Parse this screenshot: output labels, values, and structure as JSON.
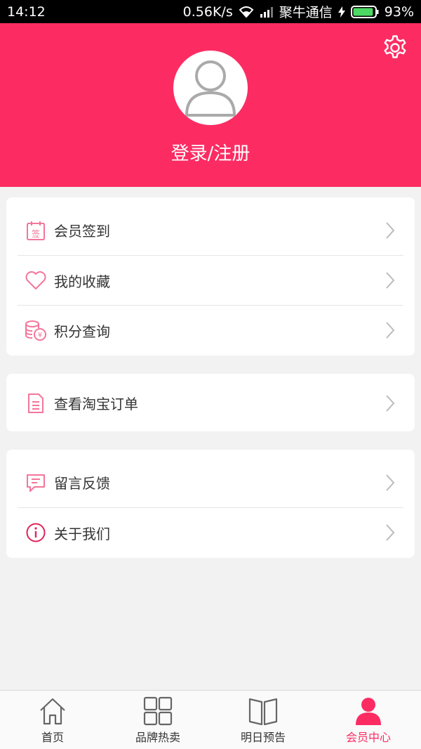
{
  "status_bar": {
    "time": "14:12",
    "speed": "0.56K/s",
    "carrier": "聚牛通信",
    "battery": "93%",
    "battery_level": 0.93
  },
  "header": {
    "login_label": "登录/注册",
    "accent_color": "#fc2c63"
  },
  "menu": {
    "group1": [
      {
        "label": "会员签到",
        "icon": "sign-in-calendar-icon"
      },
      {
        "label": "我的收藏",
        "icon": "heart-icon"
      },
      {
        "label": "积分查询",
        "icon": "coins-icon"
      }
    ],
    "group2": [
      {
        "label": "查看淘宝订单",
        "icon": "document-icon"
      }
    ],
    "group3": [
      {
        "label": "留言反馈",
        "icon": "message-icon"
      },
      {
        "label": "关于我们",
        "icon": "info-icon"
      }
    ],
    "sign_glyph": "签",
    "coin_glyph": "¥"
  },
  "bottom_nav": [
    {
      "label": "首页",
      "icon": "home-icon",
      "active": false
    },
    {
      "label": "品牌热卖",
      "icon": "grid-icon",
      "active": false
    },
    {
      "label": "明日预告",
      "icon": "book-icon",
      "active": false
    },
    {
      "label": "会员中心",
      "icon": "user-icon",
      "active": true
    }
  ]
}
